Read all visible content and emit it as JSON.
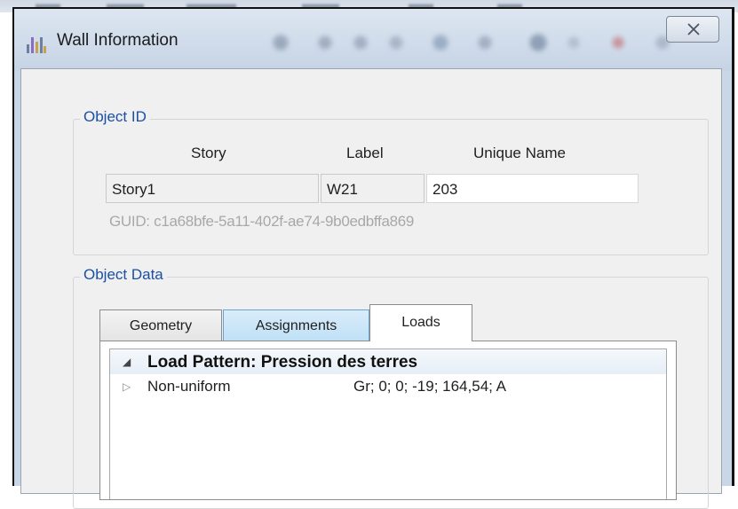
{
  "window": {
    "title": "Wall Information"
  },
  "object_id": {
    "group_title": "Object ID",
    "headers": {
      "story": "Story",
      "label": "Label",
      "unique_name": "Unique Name"
    },
    "values": {
      "story": "Story1",
      "label": "W21",
      "unique_name": "203"
    },
    "guid": "GUID:  c1a68bfe-5a11-402f-ae74-9b0edbffa869"
  },
  "object_data": {
    "group_title": "Object Data",
    "tabs": [
      {
        "label": "Geometry"
      },
      {
        "label": "Assignments"
      },
      {
        "label": "Loads"
      }
    ],
    "selected_tab": "Loads",
    "loads": {
      "pattern_title": "Load Pattern: Pression des terres",
      "rows": [
        {
          "label": "Non-uniform",
          "value": "Gr; 0; 0; -19; 164,54; A"
        }
      ]
    }
  },
  "colors": {
    "group_title": "#1a4fa3",
    "selected_tab": "#ffffff",
    "hover_tab": "#bfe0f6",
    "guid_text": "#a8a8a8"
  },
  "icons": {
    "close": "close-icon",
    "app": "etabs-app-icon",
    "expand_pattern": "expanded-triangle-icon",
    "expand_row": "collapsed-triangle-icon"
  }
}
